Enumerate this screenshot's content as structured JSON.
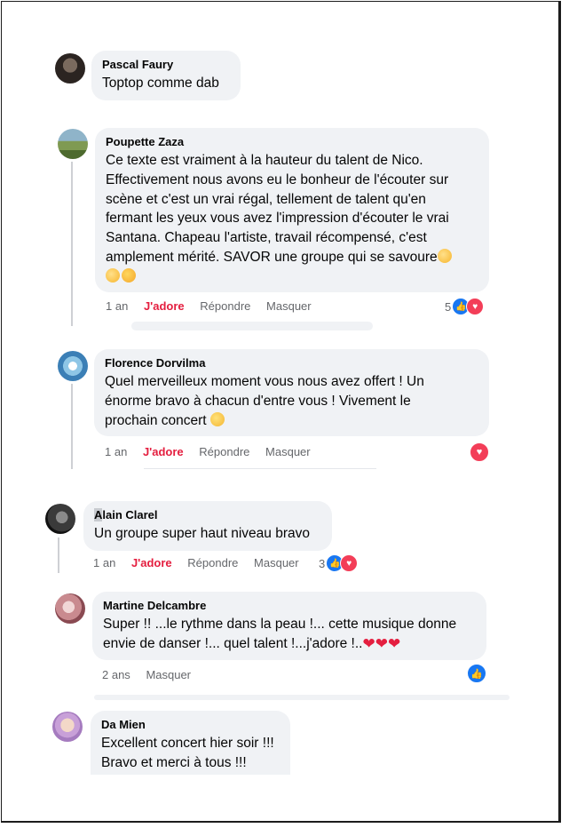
{
  "comments": [
    {
      "author": "Pascal Faury",
      "text": "Toptop comme dab"
    },
    {
      "author": "Poupette Zaza",
      "text_lines": [
        "Ce texte est vraiment à la hauteur du talent de Nico.",
        "Effectivement nous avons eu le bonheur de l'écouter sur",
        "scène et c'est un vrai régal, tellement de talent qu'en",
        "fermant les yeux vous avez l'impression d'écouter le vrai",
        "Santana. Chapeau l'artiste, travail récompensé, c'est",
        "amplement mérité. SAVOR une groupe qui se savoure"
      ],
      "time": "1 an",
      "like_label": "J'adore",
      "reply_label": "Répondre",
      "hide_label": "Masquer",
      "reaction_count": "5",
      "reaction_icons": [
        "like-icon",
        "love-icon"
      ]
    },
    {
      "author": "Florence Dorvilma",
      "text_lines": [
        "Quel merveilleux moment vous nous avez offert ! Un",
        "énorme bravo à chacun d'entre vous ! Vivement le",
        "prochain concert"
      ],
      "time": "1 an",
      "like_label": "J'adore",
      "reply_label": "Répondre",
      "hide_label": "Masquer",
      "reaction_icons": [
        "love-icon"
      ]
    },
    {
      "author_first_letter": "A",
      "author_rest": "lain Clarel",
      "text": "Un groupe super haut niveau bravo",
      "time": "1 an",
      "like_label": "J'adore",
      "reply_label": "Répondre",
      "hide_label": "Masquer",
      "reaction_count": "3",
      "reaction_icons": [
        "like-icon",
        "love-icon"
      ]
    },
    {
      "author": "Martine Delcambre",
      "text_lines": [
        "Super !! ...le rythme dans la peau !... cette musique donne",
        "envie de danser !... quel talent !...j'adore !.."
      ],
      "time": "2 ans",
      "hide_label": "Masquer",
      "reaction_icons": [
        "like-icon"
      ]
    },
    {
      "author": "Da Mien",
      "text_lines": [
        "Excellent concert hier soir !!!",
        "Bravo et merci à tous !!!"
      ]
    }
  ],
  "colors": {
    "bubble": "#f0f2f5",
    "love_action": "#e41e3f",
    "like_blue": "#1877f2",
    "love_red": "#f33e58",
    "muted": "#65676b"
  }
}
